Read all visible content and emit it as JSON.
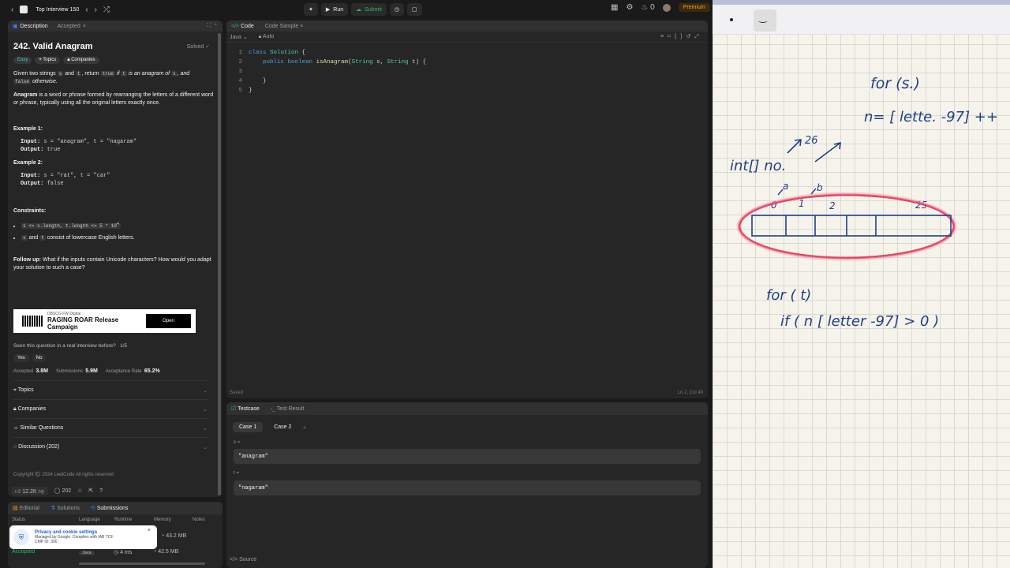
{
  "topbar": {
    "title": "Top Interview 150",
    "run": "Run",
    "submit": "Submit",
    "fire_count": "0",
    "premium": "Premium"
  },
  "problem": {
    "tabs": [
      "Description",
      "Accepted"
    ],
    "title": "242. Valid Anagram",
    "solved": "Solved",
    "difficulty": "Easy",
    "topics_chip": "Topics",
    "companies_chip": "Companies",
    "statement": {
      "p1a": "Given two strings ",
      "s": "s",
      "and": " and ",
      "t": "t",
      "p1b": ", return ",
      "true": "true",
      "p1c": " if ",
      "p1d": " is an anagram of ",
      "p1e": ", and",
      "false": "false",
      "p1f": " otherwise."
    },
    "anagram_word": "Anagram",
    "anagram_def": " is a word or phrase formed by rearranging the letters of a different word or phrase, typically using all the original letters exactly once.",
    "examples": [
      {
        "title": "Example 1:",
        "input_label": "Input:",
        "input": " s = \"anagram\", t = \"nagaram\"",
        "output_label": "Output:",
        "output": " true"
      },
      {
        "title": "Example 2:",
        "input_label": "Input:",
        "input": " s = \"rat\", t = \"car\"",
        "output_label": "Output:",
        "output": " false"
      }
    ],
    "constraints_title": "Constraints:",
    "constraint1": "1 <= s.length, t.length <= 5 * 10",
    "constraint1_sup": "4",
    "constraint2_s": "s",
    "constraint2_and": " and ",
    "constraint2_t": "t",
    "constraint2_rest": " consist of lowercase English letters.",
    "followup_label": "Follow up:",
    "followup_text": " What if the inputs contain Unicode characters? How would you adapt your solution to such a case?",
    "ad": {
      "small": "DBSCG FW Digital",
      "headline": "RAGING ROAR Release Campaign",
      "button": "Open"
    },
    "seen_question": "Seen this question in a real interview before?",
    "seen_count": "1/5",
    "yes": "Yes",
    "no": "No",
    "accepted_label": "Accepted",
    "accepted_value": "3.8M",
    "submissions_label": "Submissions",
    "submissions_value": "5.9M",
    "rate_label": "Acceptance Rate",
    "rate_value": "65.2%",
    "sections": [
      "Topics",
      "Companies",
      "Similar Questions",
      "Discussion (202)"
    ],
    "copyright": "Copyright ©️ 2024 LeetCode All rights reserved",
    "likes": "12.2K",
    "comments": "202"
  },
  "submissions": {
    "tabs": [
      "Editorial",
      "Solutions",
      "Submissions"
    ],
    "headers": [
      "Status",
      "Language",
      "Runtime",
      "Memory",
      "Notes"
    ],
    "row1_memory": "43.2 MB",
    "row2_status": "Accepted",
    "row2_lang": "Java",
    "row2_runtime": "4 ms",
    "row2_memory": "42.5 MB"
  },
  "cookie": {
    "title": "Privacy and cookie settings",
    "line1": "Managed by Google. Complies with IAB TCF.",
    "line2": "CMP ID: 300"
  },
  "code": {
    "tabs": [
      "Code",
      "Code Sample"
    ],
    "language": "Java",
    "auto": "Auto",
    "status": "Saved",
    "position": "Ln 2, Col 48"
  },
  "testcase": {
    "tabs": [
      "Testcase",
      "Test Result"
    ],
    "cases": [
      "Case 1",
      "Case 2"
    ],
    "var1_label": "s =",
    "var1_value": "\"anagram\"",
    "var2_label": "t =",
    "var2_value": "\"nagaram\"",
    "source": "Source"
  },
  "whiteboard": {
    "line1": "for (s.)",
    "line2": "n= [ lette. -97] ++",
    "size_note": "26",
    "array_label": "int[] no.",
    "a": "a",
    "b": "b",
    "idx0": "0",
    "idx1": "1",
    "idx2": "2",
    "idx25": "25",
    "line3": "for ( t)",
    "line4": "if ( n [ letter -97] > 0 )"
  },
  "colors": {
    "accent": "#ffa116",
    "success": "#2cbb5d",
    "ink": "#1f3f8a",
    "highlight": "#e3224a"
  }
}
